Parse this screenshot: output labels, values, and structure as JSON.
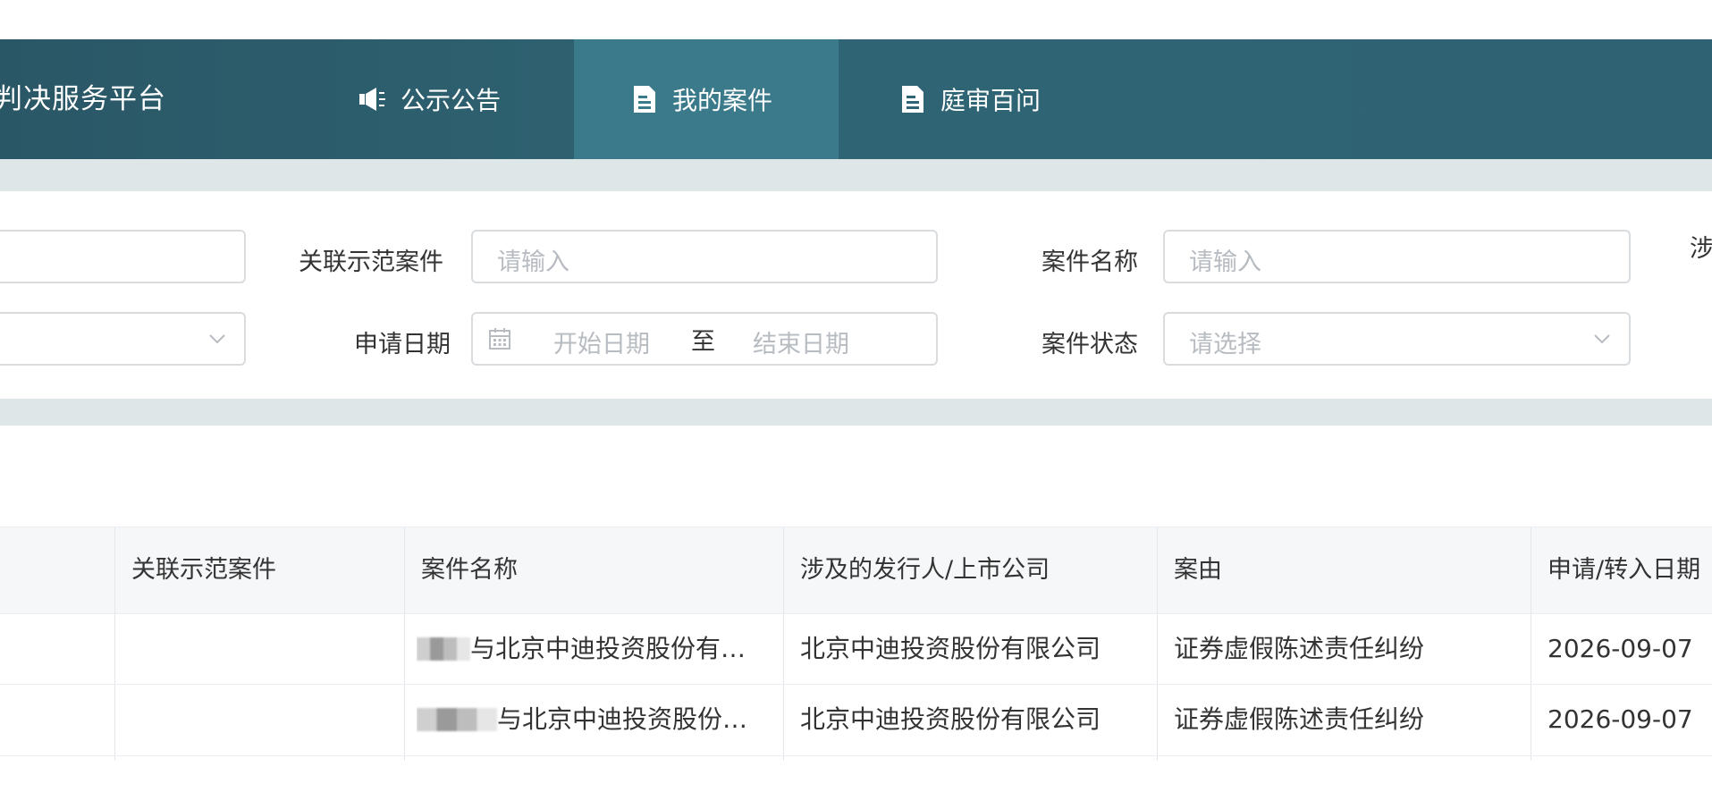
{
  "header": {
    "brand": "判决服务平台",
    "nav": [
      {
        "label": "公示公告",
        "icon": "megaphone-icon"
      },
      {
        "label": "我的案件",
        "icon": "document-icon",
        "active": true
      },
      {
        "label": "庭审百问",
        "icon": "document-icon"
      }
    ]
  },
  "filters": {
    "related_case": {
      "label": "关联示范案件",
      "placeholder": "请输入"
    },
    "case_name": {
      "label": "案件名称",
      "placeholder": "请输入"
    },
    "apply_date": {
      "label": "申请日期",
      "start_placeholder": "开始日期",
      "separator": "至",
      "end_placeholder": "结束日期"
    },
    "case_status": {
      "label": "案件状态",
      "placeholder": "请选择"
    },
    "truncated_label": "涉"
  },
  "table": {
    "columns": [
      "关联示范案件",
      "案件名称",
      "涉及的发行人/上市公司",
      "案由",
      "申请/转入日期"
    ],
    "rows": [
      {
        "related": "",
        "name": "与北京中迪投资股份有…",
        "company": "北京中迪投资股份有限公司",
        "cause": "证券虚假陈述责任纠纷",
        "date": "2026-09-07"
      },
      {
        "related": "",
        "name": "与北京中迪投资股份…",
        "company": "北京中迪投资股份有限公司",
        "cause": "证券虚假陈述责任纠纷",
        "date": "2026-09-07"
      }
    ]
  },
  "colors": {
    "nav_bg": "#2f6474",
    "nav_active": "#3a7a8b",
    "band": "#dfe6e8"
  }
}
